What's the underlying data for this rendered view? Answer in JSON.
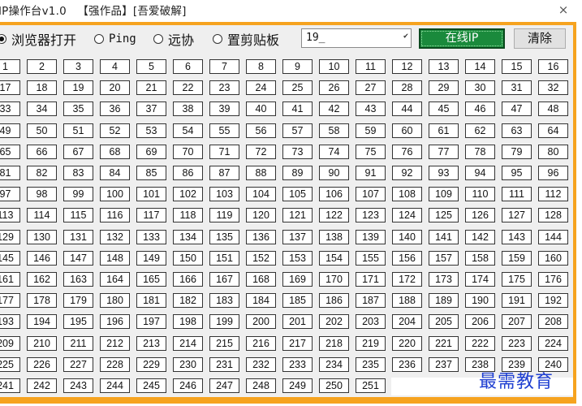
{
  "window": {
    "title": "IP操作台v1.0   【强作品】[吾爱破解]",
    "close_glyph": "×"
  },
  "options": [
    {
      "label": "浏览器打开",
      "selected": true
    },
    {
      "label": "Ping",
      "selected": false
    },
    {
      "label": "远协",
      "selected": false
    },
    {
      "label": "置剪贴板",
      "selected": false
    }
  ],
  "ip_prefix": {
    "value": "19_",
    "caret_glyph": "✔"
  },
  "buttons": {
    "online": "在线IP",
    "clear": "清除"
  },
  "colors": {
    "frame": "#f6a31f",
    "online_button": "#1a8a3c",
    "watermark": "#1f3fd1"
  },
  "grid": {
    "first": 1,
    "last": 251,
    "columns": 16
  },
  "watermark": "最需教育"
}
